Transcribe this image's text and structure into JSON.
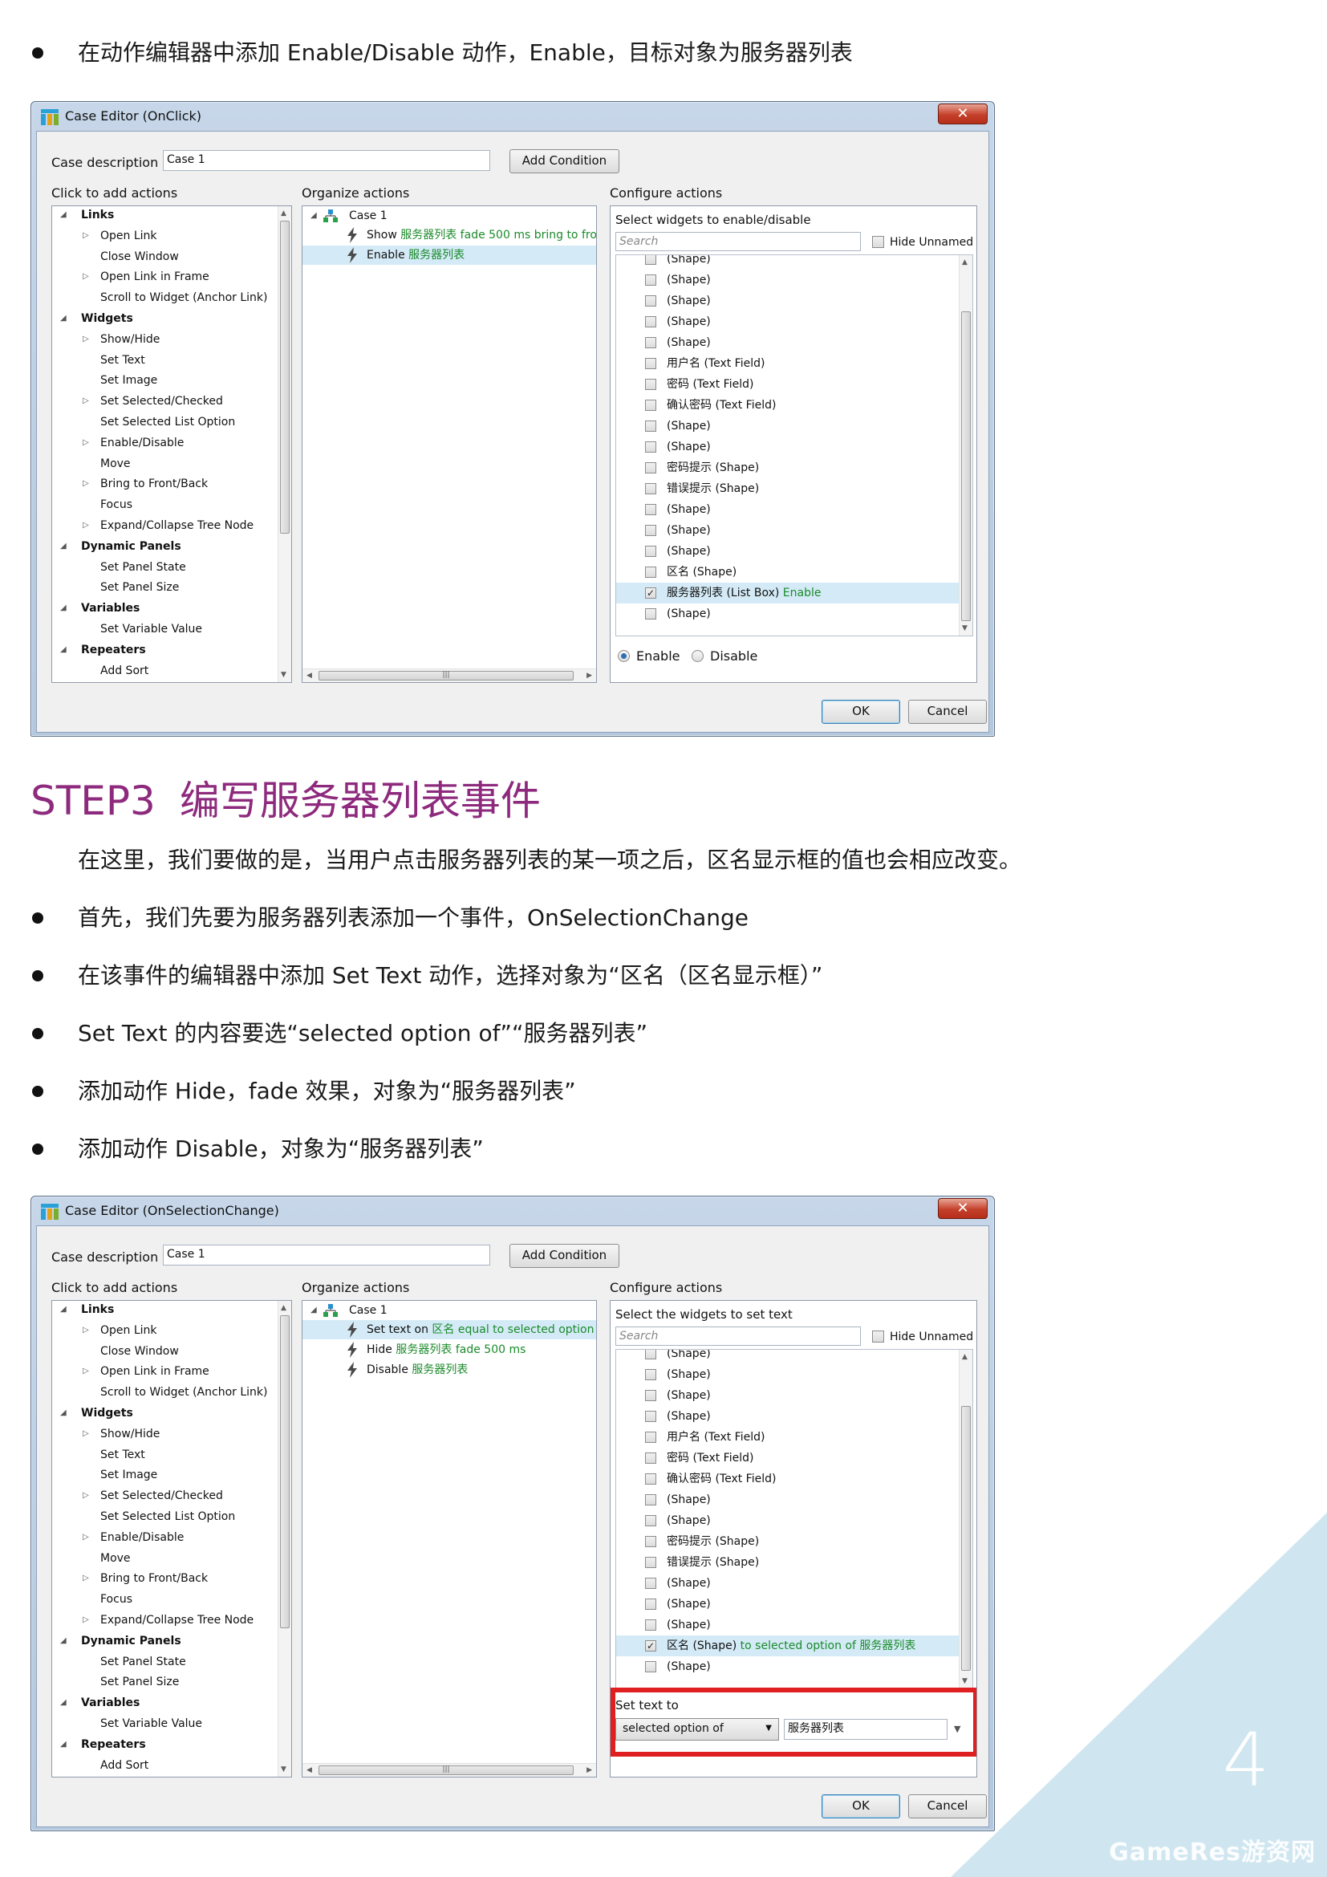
{
  "page": {
    "number": "4",
    "watermark": "GameRes游资网",
    "colors": {
      "accent": "#8e2a7d",
      "triangle": "#cfe6f0",
      "highlight": "#e02020",
      "action_text": "#1b8a2a"
    }
  },
  "intro_bullet": "在动作编辑器中添加 Enable/Disable 动作，Enable，目标对象为服务器列表",
  "step": {
    "label": "STEP3",
    "title": "编写服务器列表事件"
  },
  "step_intro": "在这里，我们要做的是，当用户点击服务器列表的某一项之后，区名显示框的值也会相应改变。",
  "bullets": [
    "首先，我们先要为服务器列表添加一个事件，OnSelectionChange",
    "在该事件的编辑器中添加 Set Text 动作，选择对象为“区名（区名显示框）”",
    "Set Text 的内容要选“selected option of”“服务器列表”",
    "添加动作 Hide，fade 效果，对象为“服务器列表”",
    "添加动作 Disable，对象为“服务器列表”"
  ],
  "dialog_common": {
    "case_description_label": "Case description",
    "case_description_value": "Case 1",
    "add_condition": "Add Condition",
    "click_to_add": "Click to add actions",
    "organize": "Organize actions",
    "configure": "Configure actions",
    "search_placeholder": "Search",
    "hide_unnamed": "Hide Unnamed",
    "ok": "OK",
    "cancel": "Cancel",
    "case_node": "Case 1",
    "action_tree": [
      {
        "label": "Links",
        "cat": true,
        "exp": "◢"
      },
      {
        "label": "Open Link",
        "exp": "▷"
      },
      {
        "label": "Close Window"
      },
      {
        "label": "Open Link in Frame",
        "exp": "▷"
      },
      {
        "label": "Scroll to Widget (Anchor Link)"
      },
      {
        "label": "Widgets",
        "cat": true,
        "exp": "◢"
      },
      {
        "label": "Show/Hide",
        "exp": "▷"
      },
      {
        "label": "Set Text"
      },
      {
        "label": "Set Image"
      },
      {
        "label": "Set Selected/Checked",
        "exp": "▷"
      },
      {
        "label": "Set Selected List Option"
      },
      {
        "label": "Enable/Disable",
        "exp": "▷"
      },
      {
        "label": "Move"
      },
      {
        "label": "Bring to Front/Back",
        "exp": "▷"
      },
      {
        "label": "Focus"
      },
      {
        "label": "Expand/Collapse Tree Node",
        "exp": "▷"
      },
      {
        "label": "Dynamic Panels",
        "cat": true,
        "exp": "◢"
      },
      {
        "label": "Set Panel State"
      },
      {
        "label": "Set Panel Size"
      },
      {
        "label": "Variables",
        "cat": true,
        "exp": "◢"
      },
      {
        "label": "Set Variable Value"
      },
      {
        "label": "Repeaters",
        "cat": true,
        "exp": "◢"
      },
      {
        "label": "Add Sort"
      }
    ]
  },
  "dialog1": {
    "title": "Case Editor (OnClick)",
    "org_actions": [
      {
        "prefix": "Show ",
        "target": "服务器列表 fade 500 ms bring to fro",
        "selected": false
      },
      {
        "prefix": "Enable ",
        "target": "服务器列表",
        "selected": true
      }
    ],
    "configure_heading": "Select widgets to enable/disable",
    "widgets": [
      {
        "label": "(Shape)"
      },
      {
        "label": "(Shape)"
      },
      {
        "label": "(Shape)"
      },
      {
        "label": "(Shape)"
      },
      {
        "label": "(Shape)"
      },
      {
        "label": "用户名 (Text Field)"
      },
      {
        "label": "密码 (Text Field)"
      },
      {
        "label": "确认密码 (Text Field)"
      },
      {
        "label": "(Shape)"
      },
      {
        "label": "(Shape)"
      },
      {
        "label": "密码提示 (Shape)"
      },
      {
        "label": "错误提示 (Shape)"
      },
      {
        "label": "(Shape)"
      },
      {
        "label": "(Shape)"
      },
      {
        "label": "(Shape)"
      },
      {
        "label": "区名 (Shape)"
      },
      {
        "label": "服务器列表 (List Box)",
        "checked": true,
        "selected": true,
        "suffix": "Enable"
      },
      {
        "label": "(Shape)"
      }
    ],
    "radio_enable": "Enable",
    "radio_disable": "Disable"
  },
  "dialog2": {
    "title": "Case Editor (OnSelectionChange)",
    "org_actions": [
      {
        "prefix": "Set text on ",
        "target": "区名 equal to selected option of",
        "selected": true
      },
      {
        "prefix": "Hide ",
        "target": "服务器列表 fade 500 ms",
        "selected": false
      },
      {
        "prefix": "Disable ",
        "target": "服务器列表",
        "selected": false
      }
    ],
    "configure_heading": "Select the widgets to set text",
    "widgets": [
      {
        "label": "(Shape)"
      },
      {
        "label": "(Shape)"
      },
      {
        "label": "(Shape)"
      },
      {
        "label": "(Shape)"
      },
      {
        "label": "用户名 (Text Field)"
      },
      {
        "label": "密码 (Text Field)"
      },
      {
        "label": "确认密码 (Text Field)"
      },
      {
        "label": "(Shape)"
      },
      {
        "label": "(Shape)"
      },
      {
        "label": "密码提示 (Shape)"
      },
      {
        "label": "错误提示 (Shape)"
      },
      {
        "label": "(Shape)"
      },
      {
        "label": "(Shape)"
      },
      {
        "label": "(Shape)"
      },
      {
        "label": "区名 (Shape)",
        "checked": true,
        "selected": true,
        "suffix": "to selected option of 服务器列表"
      },
      {
        "label": "(Shape)"
      }
    ],
    "set_text_to": "Set text to",
    "set_text_mode": "selected option of",
    "set_text_target": "服务器列表"
  }
}
